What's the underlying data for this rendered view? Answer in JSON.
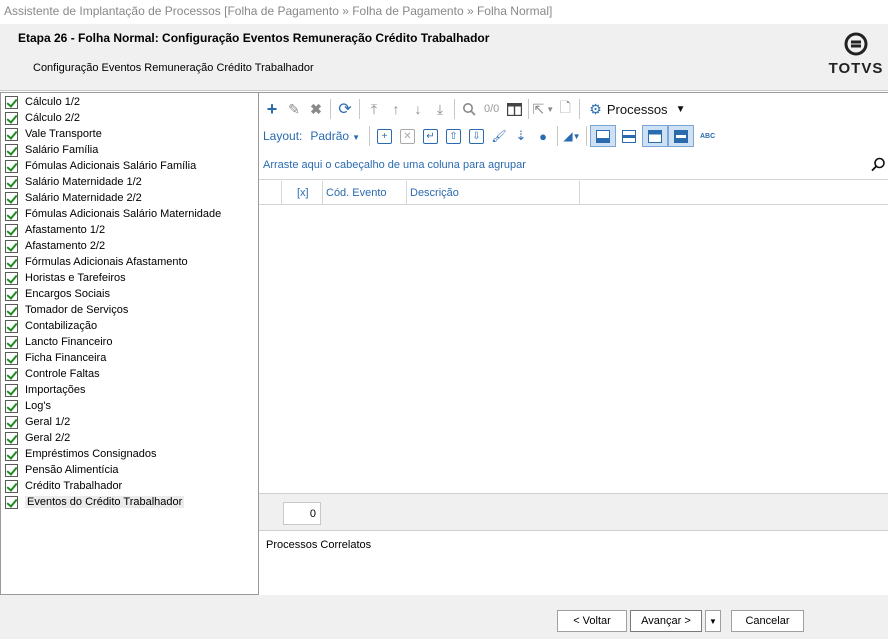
{
  "window": {
    "title": "Assistente de Implantação de Processos [Folha de Pagamento » Folha de Pagamento » Folha Normal]"
  },
  "header": {
    "step_title": "Etapa 26 - Folha Normal: Configuração Eventos Remuneração Crédito Trabalhador",
    "step_subtitle": "Configuração Eventos Remuneração Crédito Trabalhador",
    "logo_text": "TOTVS"
  },
  "tree": {
    "items": [
      {
        "label": "Cálculo 1/2",
        "checked": true
      },
      {
        "label": "Cálculo 2/2",
        "checked": true
      },
      {
        "label": "Vale Transporte",
        "checked": true
      },
      {
        "label": "Salário Família",
        "checked": true
      },
      {
        "label": "Fómulas Adicionais Salário Família",
        "checked": true
      },
      {
        "label": "Salário Maternidade 1/2",
        "checked": true
      },
      {
        "label": "Salário Maternidade 2/2",
        "checked": true
      },
      {
        "label": "Fómulas Adicionais Salário Maternidade",
        "checked": true
      },
      {
        "label": "Afastamento 1/2",
        "checked": true
      },
      {
        "label": "Afastamento 2/2",
        "checked": true
      },
      {
        "label": "Fórmulas Adicionais Afastamento",
        "checked": true
      },
      {
        "label": "Horistas e Tarefeiros",
        "checked": true
      },
      {
        "label": "Encargos Sociais",
        "checked": true
      },
      {
        "label": "Tomador de Serviços",
        "checked": true
      },
      {
        "label": "Contabilização",
        "checked": true
      },
      {
        "label": "Lancto Financeiro",
        "checked": true
      },
      {
        "label": "Ficha Financeira",
        "checked": true
      },
      {
        "label": "Controle Faltas",
        "checked": true
      },
      {
        "label": "Importações",
        "checked": true
      },
      {
        "label": "Log's",
        "checked": true
      },
      {
        "label": "Geral 1/2",
        "checked": true
      },
      {
        "label": "Geral 2/2",
        "checked": true
      },
      {
        "label": "Empréstimos Consignados",
        "checked": true
      },
      {
        "label": "Pensão Alimentícia",
        "checked": true
      },
      {
        "label": "Crédito Trabalhador",
        "checked": true
      },
      {
        "label": "Eventos do Crédito Trabalhador",
        "checked": true,
        "selected": true
      }
    ]
  },
  "toolbar": {
    "record_counter": "0/0",
    "processos_label": "Processos",
    "layout_label": "Layout:",
    "layout_value": "Padrão",
    "abc_label": "ABC"
  },
  "grid": {
    "group_hint": "Arraste aqui o cabeçalho de uma coluna para agrupar",
    "columns": [
      "[x]",
      "Cód. Evento",
      "Descrição"
    ],
    "rows": [],
    "record_count": "0"
  },
  "correlatos": {
    "label": "Processos Correlatos"
  },
  "buttons": {
    "back": "< Voltar",
    "next": "Avançar >",
    "cancel": "Cancelar"
  }
}
